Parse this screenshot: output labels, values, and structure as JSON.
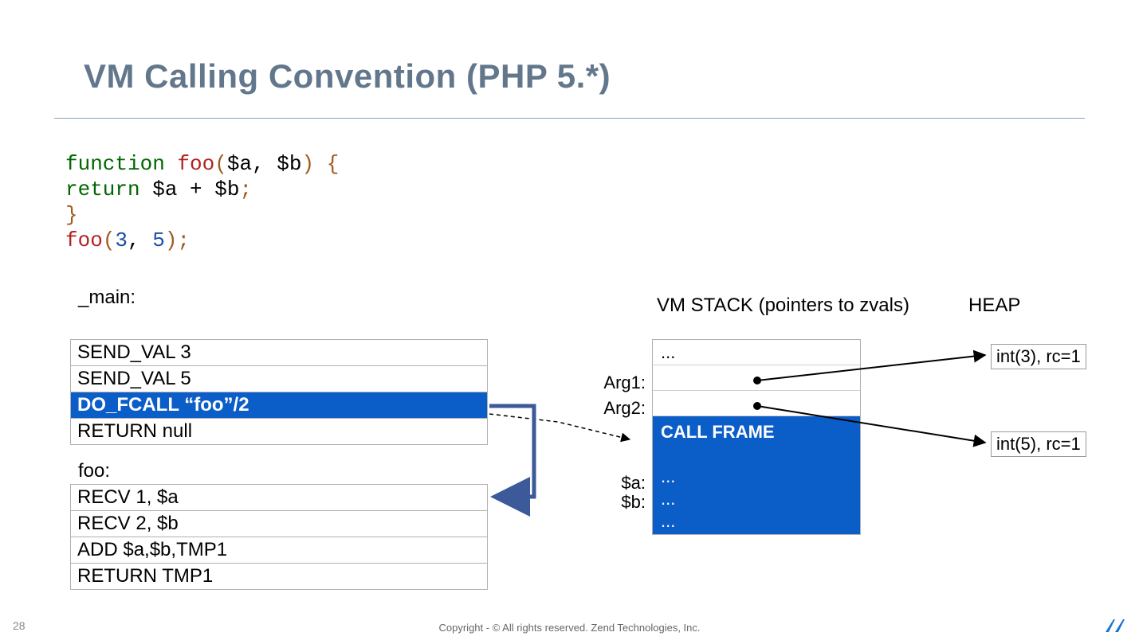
{
  "title": "VM Calling Convention (PHP 5.*)",
  "code": {
    "l1": {
      "kw": "function ",
      "fn": "foo",
      "rest1": "(",
      "args": "$a, $b",
      "rest2": ") {"
    },
    "l2": {
      "kw": "    return ",
      "expr": "$a + $b",
      "semi": ";"
    },
    "l3": "}",
    "l4": {
      "fn": "foo",
      "open": "(",
      "n1": "3",
      "comma": ", ",
      "n2": "5",
      "close": ");"
    }
  },
  "labels": {
    "main": "_main:",
    "foo": "foo:"
  },
  "main_ops": [
    "SEND_VAL 3",
    "SEND_VAL 5",
    "DO_FCALL  “foo”/2",
    "RETURN null"
  ],
  "main_highlight_index": 2,
  "foo_ops": [
    "RECV 1, $a",
    "RECV 2, $b",
    "ADD $a,$b,TMP1",
    "RETURN TMP1"
  ],
  "vm": {
    "title": "VM STACK (pointers to zvals)",
    "heap_title": "HEAP",
    "row_labels": [
      "",
      "Arg1:",
      "Arg2:",
      "",
      "$a:",
      "$b:",
      ""
    ],
    "cells": [
      "...",
      "",
      "",
      "CALL FRAME",
      "...",
      "...",
      "..."
    ]
  },
  "heap": {
    "int3": "int(3), rc=1",
    "int5": "int(5), rc=1"
  },
  "page": "28",
  "copyright": "Copyright - © All rights reserved. Zend Technologies, Inc."
}
